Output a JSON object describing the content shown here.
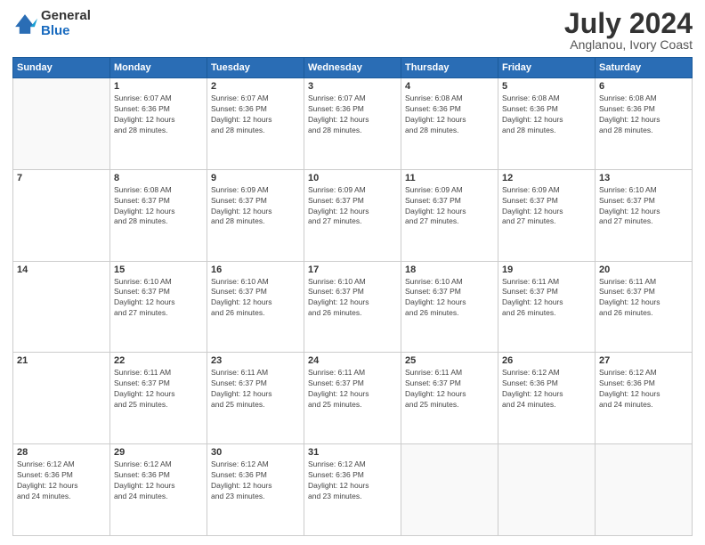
{
  "logo": {
    "general": "General",
    "blue": "Blue"
  },
  "title": {
    "month_year": "July 2024",
    "location": "Anglanou, Ivory Coast"
  },
  "days_of_week": [
    "Sunday",
    "Monday",
    "Tuesday",
    "Wednesday",
    "Thursday",
    "Friday",
    "Saturday"
  ],
  "weeks": [
    [
      {
        "day": "",
        "info": ""
      },
      {
        "day": "1",
        "info": "Sunrise: 6:07 AM\nSunset: 6:36 PM\nDaylight: 12 hours\nand 28 minutes."
      },
      {
        "day": "2",
        "info": "Sunrise: 6:07 AM\nSunset: 6:36 PM\nDaylight: 12 hours\nand 28 minutes."
      },
      {
        "day": "3",
        "info": "Sunrise: 6:07 AM\nSunset: 6:36 PM\nDaylight: 12 hours\nand 28 minutes."
      },
      {
        "day": "4",
        "info": "Sunrise: 6:08 AM\nSunset: 6:36 PM\nDaylight: 12 hours\nand 28 minutes."
      },
      {
        "day": "5",
        "info": "Sunrise: 6:08 AM\nSunset: 6:36 PM\nDaylight: 12 hours\nand 28 minutes."
      },
      {
        "day": "6",
        "info": "Sunrise: 6:08 AM\nSunset: 6:36 PM\nDaylight: 12 hours\nand 28 minutes."
      }
    ],
    [
      {
        "day": "7",
        "info": ""
      },
      {
        "day": "8",
        "info": "Sunrise: 6:08 AM\nSunset: 6:37 PM\nDaylight: 12 hours\nand 28 minutes."
      },
      {
        "day": "9",
        "info": "Sunrise: 6:09 AM\nSunset: 6:37 PM\nDaylight: 12 hours\nand 28 minutes."
      },
      {
        "day": "10",
        "info": "Sunrise: 6:09 AM\nSunset: 6:37 PM\nDaylight: 12 hours\nand 27 minutes."
      },
      {
        "day": "11",
        "info": "Sunrise: 6:09 AM\nSunset: 6:37 PM\nDaylight: 12 hours\nand 27 minutes."
      },
      {
        "day": "12",
        "info": "Sunrise: 6:09 AM\nSunset: 6:37 PM\nDaylight: 12 hours\nand 27 minutes."
      },
      {
        "day": "13",
        "info": "Sunrise: 6:10 AM\nSunset: 6:37 PM\nDaylight: 12 hours\nand 27 minutes."
      }
    ],
    [
      {
        "day": "14",
        "info": ""
      },
      {
        "day": "15",
        "info": "Sunrise: 6:10 AM\nSunset: 6:37 PM\nDaylight: 12 hours\nand 27 minutes."
      },
      {
        "day": "16",
        "info": "Sunrise: 6:10 AM\nSunset: 6:37 PM\nDaylight: 12 hours\nand 26 minutes."
      },
      {
        "day": "17",
        "info": "Sunrise: 6:10 AM\nSunset: 6:37 PM\nDaylight: 12 hours\nand 26 minutes."
      },
      {
        "day": "18",
        "info": "Sunrise: 6:10 AM\nSunset: 6:37 PM\nDaylight: 12 hours\nand 26 minutes."
      },
      {
        "day": "19",
        "info": "Sunrise: 6:11 AM\nSunset: 6:37 PM\nDaylight: 12 hours\nand 26 minutes."
      },
      {
        "day": "20",
        "info": "Sunrise: 6:11 AM\nSunset: 6:37 PM\nDaylight: 12 hours\nand 26 minutes."
      }
    ],
    [
      {
        "day": "21",
        "info": ""
      },
      {
        "day": "22",
        "info": "Sunrise: 6:11 AM\nSunset: 6:37 PM\nDaylight: 12 hours\nand 25 minutes."
      },
      {
        "day": "23",
        "info": "Sunrise: 6:11 AM\nSunset: 6:37 PM\nDaylight: 12 hours\nand 25 minutes."
      },
      {
        "day": "24",
        "info": "Sunrise: 6:11 AM\nSunset: 6:37 PM\nDaylight: 12 hours\nand 25 minutes."
      },
      {
        "day": "25",
        "info": "Sunrise: 6:11 AM\nSunset: 6:37 PM\nDaylight: 12 hours\nand 25 minutes."
      },
      {
        "day": "26",
        "info": "Sunrise: 6:12 AM\nSunset: 6:36 PM\nDaylight: 12 hours\nand 24 minutes."
      },
      {
        "day": "27",
        "info": "Sunrise: 6:12 AM\nSunset: 6:36 PM\nDaylight: 12 hours\nand 24 minutes."
      }
    ],
    [
      {
        "day": "28",
        "info": "Sunrise: 6:12 AM\nSunset: 6:36 PM\nDaylight: 12 hours\nand 24 minutes."
      },
      {
        "day": "29",
        "info": "Sunrise: 6:12 AM\nSunset: 6:36 PM\nDaylight: 12 hours\nand 24 minutes."
      },
      {
        "day": "30",
        "info": "Sunrise: 6:12 AM\nSunset: 6:36 PM\nDaylight: 12 hours\nand 23 minutes."
      },
      {
        "day": "31",
        "info": "Sunrise: 6:12 AM\nSunset: 6:36 PM\nDaylight: 12 hours\nand 23 minutes."
      },
      {
        "day": "",
        "info": ""
      },
      {
        "day": "",
        "info": ""
      },
      {
        "day": "",
        "info": ""
      }
    ]
  ]
}
